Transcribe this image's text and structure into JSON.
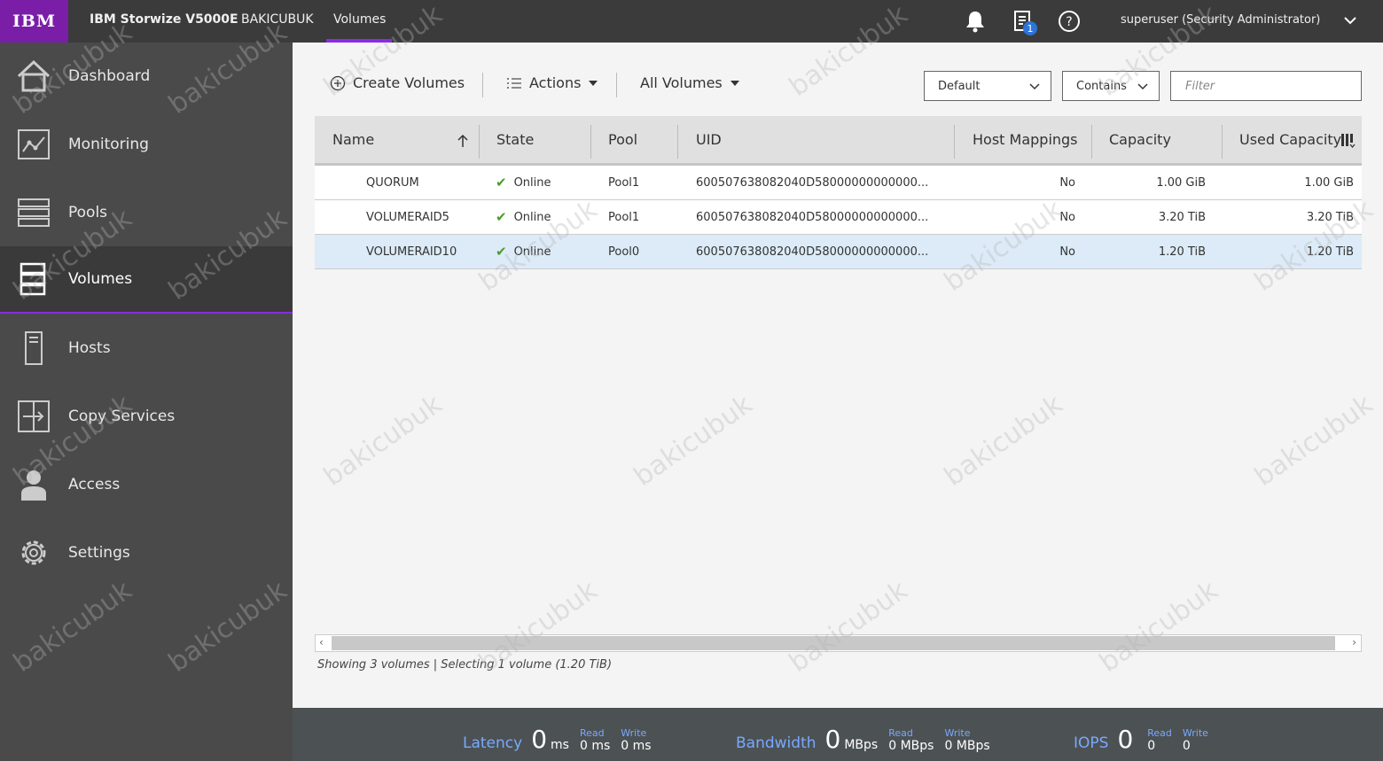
{
  "topbar": {
    "logo": "IBM",
    "product": "IBM Storwize V5000E",
    "system": "BAKICUBUK",
    "page": "Volumes",
    "tasks_badge": "1",
    "user": "superuser (Security Administrator)"
  },
  "sidebar": {
    "items": [
      {
        "label": "Dashboard",
        "icon": "home-icon"
      },
      {
        "label": "Monitoring",
        "icon": "monitoring-icon"
      },
      {
        "label": "Pools",
        "icon": "pools-icon"
      },
      {
        "label": "Volumes",
        "icon": "volumes-icon",
        "active": true
      },
      {
        "label": "Hosts",
        "icon": "hosts-icon"
      },
      {
        "label": "Copy Services",
        "icon": "copy-services-icon"
      },
      {
        "label": "Access",
        "icon": "access-icon"
      },
      {
        "label": "Settings",
        "icon": "gear-icon"
      }
    ]
  },
  "toolbar": {
    "create_label": "Create Volumes",
    "actions_label": "Actions",
    "all_volumes_label": "All Volumes",
    "view_select": "Default",
    "match_select": "Contains",
    "filter_placeholder": "Filter"
  },
  "table": {
    "columns": [
      "Name",
      "State",
      "Pool",
      "UID",
      "Host Mappings",
      "Capacity",
      "Used Capacity"
    ],
    "rows": [
      {
        "name": "QUORUM",
        "state": "Online",
        "pool": "Pool1",
        "uid": "600507638082040D58000000000000...",
        "host_mappings": "No",
        "capacity": "1.00 GiB",
        "used": "1.00 GiB"
      },
      {
        "name": "VOLUMERAID5",
        "state": "Online",
        "pool": "Pool1",
        "uid": "600507638082040D58000000000000...",
        "host_mappings": "No",
        "capacity": "3.20 TiB",
        "used": "3.20 TiB"
      },
      {
        "name": "VOLUMERAID10",
        "state": "Online",
        "pool": "Pool0",
        "uid": "600507638082040D58000000000000...",
        "host_mappings": "No",
        "capacity": "1.20 TiB",
        "used": "1.20 TiB",
        "selected": true
      }
    ]
  },
  "status": {
    "text": "Showing 3 volumes | Selecting 1 volume (1.20 TiB)"
  },
  "perf": {
    "latency": {
      "title": "Latency",
      "value": "0",
      "unit": "ms",
      "read_label": "Read",
      "read": "0 ms",
      "write_label": "Write",
      "write": "0 ms"
    },
    "bandwidth": {
      "title": "Bandwidth",
      "value": "0",
      "unit": "MBps",
      "read_label": "Read",
      "read": "0 MBps",
      "write_label": "Write",
      "write": "0 MBps"
    },
    "iops": {
      "title": "IOPS",
      "value": "0",
      "read_label": "Read",
      "read": "0",
      "write_label": "Write",
      "write": "0"
    }
  },
  "watermark": "bakicubuk",
  "colors": {
    "brand": "#7a1ea8",
    "accent": "#8a2be2",
    "online": "#4a9d2a",
    "selected_row": "#dcebf7",
    "perf_label": "#78a9ff"
  }
}
